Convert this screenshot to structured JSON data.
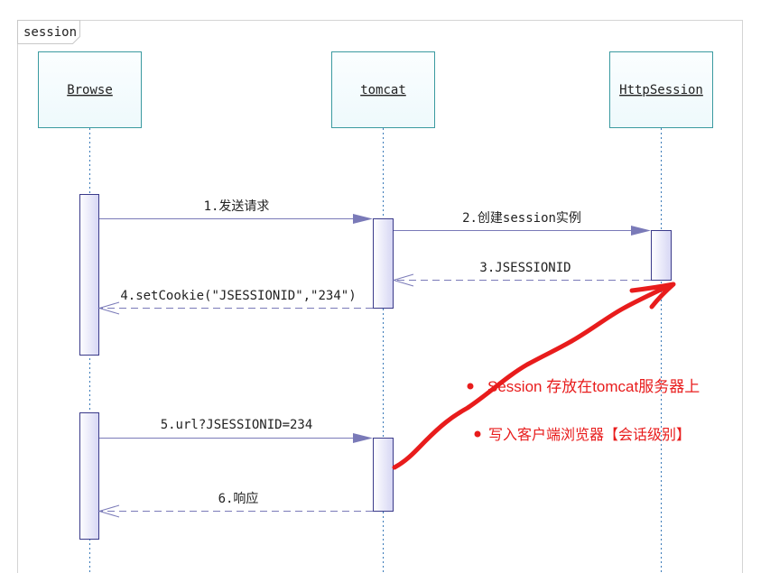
{
  "frame": {
    "title": "session"
  },
  "participants": [
    {
      "id": "browse",
      "label": "Browse"
    },
    {
      "id": "tomcat",
      "label": "tomcat"
    },
    {
      "id": "httpsession",
      "label": "HttpSession"
    }
  ],
  "messages": [
    {
      "label": "1.发送请求",
      "style": "solid"
    },
    {
      "label": "2.创建session实例",
      "style": "solid"
    },
    {
      "label": "3.JSESSIONID",
      "style": "dashed"
    },
    {
      "label": "4.setCookie(\"JSESSIONID\",\"234\")",
      "style": "dashed"
    },
    {
      "label": "5.url?JSESSIONID=234",
      "style": "solid"
    },
    {
      "label": "6.响应",
      "style": "dashed"
    }
  ],
  "annotations": [
    {
      "text": "Session 存放在tomcat服务器上"
    },
    {
      "text": "写入客户端浏览器【会话级别】"
    }
  ],
  "colors": {
    "participant_border": "#3a9aa0",
    "participant_fill": "#f2fbfd",
    "lifeline": "#3a7ab8",
    "activation_border": "#3a3a8a",
    "activation_fill": "#e8e8fa",
    "message_line": "#7a7ab8",
    "annotation_red": "#e81c1c"
  }
}
